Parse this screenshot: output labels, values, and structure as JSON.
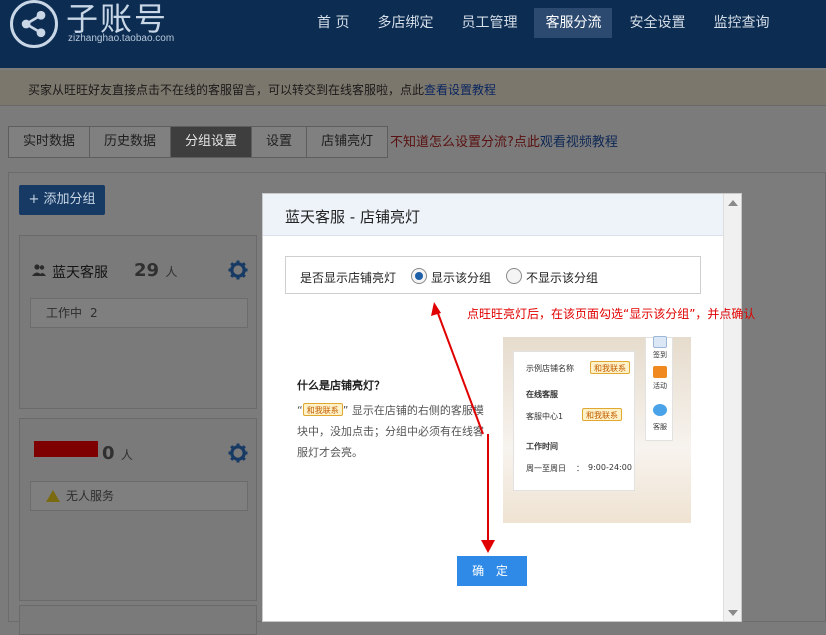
{
  "header": {
    "logo_title": "子账号",
    "logo_url": "zizhanghao.taobao.com",
    "nav": [
      "首 页",
      "多店绑定",
      "员工管理",
      "客服分流",
      "安全设置",
      "监控查询"
    ]
  },
  "notice": {
    "text": "买家从旺旺好友直接点击不在线的客服留言，可以转交到在线客服啦，点此",
    "link": "查看设置教程"
  },
  "tabs": {
    "items": [
      "实时数据",
      "历史数据",
      "分组设置",
      "设置",
      "店铺亮灯"
    ],
    "hint": "不知道怎么设置分流?点此",
    "hint_link": "观看视频教程"
  },
  "content": {
    "add_group": "+ 添加分组",
    "groups": [
      {
        "name": "蓝天客服",
        "count": "29",
        "unit": "人",
        "status": "工作中",
        "status_count": "2"
      },
      {
        "name": "",
        "count": "0",
        "unit": "人",
        "status": "无人服务"
      }
    ]
  },
  "modal": {
    "title": "蓝天客服 - 店铺亮灯",
    "option_label": "是否显示店铺亮灯",
    "option_show": "显示该分组",
    "option_hide": "不显示该分组",
    "selected": "显示该分组",
    "red_note": "点旺旺亮灯后，在该页面勾选“显示该分组”，并点确认",
    "what_title": "什么是店铺亮灯？",
    "what_desc_open": "“",
    "what_badge": "和我联系",
    "what_desc_rest": "” 显示在店铺的右侧的客服模块中，没加点击；分组中必须有在线客服灯才会亮。",
    "illustration": {
      "shop_name": "示例店铺名称",
      "contact_badge": "和我联系",
      "online_title": "在线客服",
      "agent": "客服中心1",
      "hours_title": "工作时间",
      "hours_days": "周一至周日",
      "hours_colon": "：",
      "hours_time": "9:00-24:00",
      "side_sign": "签到",
      "side_activity": "活动",
      "side_service": "客服"
    },
    "confirm": "确 定"
  },
  "colors": {
    "accent": "#2e8ae6",
    "note_red": "#e10000",
    "header_bg": "#0c2c52"
  }
}
